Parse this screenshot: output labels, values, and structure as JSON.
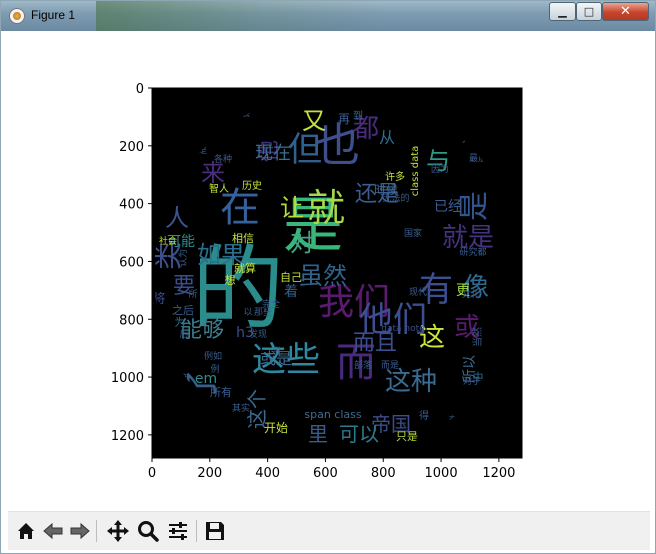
{
  "window": {
    "title": "Figure 1",
    "controls": {
      "minimize": "▁",
      "maximize": "□",
      "close": "✕"
    }
  },
  "plot": {
    "x_ticks": [
      "0",
      "200",
      "400",
      "600",
      "800",
      "1000",
      "1200"
    ],
    "y_ticks": [
      "0",
      "200",
      "400",
      "600",
      "800",
      "1000",
      "1200"
    ],
    "x_tick_values": [
      0,
      200,
      400,
      600,
      800,
      1000,
      1200
    ],
    "y_tick_values": [
      0,
      200,
      400,
      600,
      800,
      1000,
      1200
    ],
    "x_range": [
      0,
      1280
    ],
    "y_range": [
      0,
      1280
    ],
    "image_background": "#000000"
  },
  "wordcloud": {
    "words": [
      {
        "t": "的",
        "color": "#2a8d8c"
      },
      {
        "t": "是",
        "color": "#38b77a"
      },
      {
        "t": "在",
        "color": "#35619c"
      },
      {
        "t": "也",
        "color": "#3e4f8c"
      },
      {
        "t": "但",
        "color": "#32608e"
      },
      {
        "t": "就",
        "color": "#a3d94a"
      },
      {
        "t": "我们",
        "color": "#5a1b6e"
      },
      {
        "t": "而",
        "color": "#4a2a7e"
      },
      {
        "t": "了",
        "color": "#35608c"
      },
      {
        "t": "这些",
        "color": "#2d88a0"
      },
      {
        "t": "他们",
        "color": "#3b4f92"
      },
      {
        "t": "有",
        "color": "#3b4f92"
      },
      {
        "t": "像",
        "color": "#2f6a8f"
      },
      {
        "t": "是",
        "color": "#33558f"
      },
      {
        "t": "就是",
        "color": "#46337f"
      },
      {
        "t": "或",
        "color": "#5a1b6e"
      },
      {
        "t": "这",
        "color": "#cde43a"
      },
      {
        "t": "如果",
        "color": "#2b6e8e"
      },
      {
        "t": "虽然",
        "color": "#30628c"
      },
      {
        "t": "都",
        "color": "#4a2d7d"
      },
      {
        "t": "还是",
        "color": "#3a5d8f"
      },
      {
        "t": "让",
        "color": "#b5df3b"
      },
      {
        "t": "对",
        "color": "#45a285"
      },
      {
        "t": "又",
        "color": "#c4e23a"
      },
      {
        "t": "与",
        "color": "#2c9c88"
      },
      {
        "t": "类",
        "color": "#3e4f8c"
      },
      {
        "t": "人",
        "color": "#3b528b"
      },
      {
        "t": "来",
        "color": "#4a2d7d"
      },
      {
        "t": "他",
        "color": "#442f7a"
      },
      {
        "t": "现在",
        "color": "#3b6e92"
      },
      {
        "t": "从",
        "color": "#2e6f8e"
      },
      {
        "t": "要",
        "color": "#3a4f90"
      },
      {
        "t": "能够",
        "color": "#3b7d8f"
      },
      {
        "t": "这种",
        "color": "#3a6b91"
      },
      {
        "t": "而且",
        "color": "#3a4f90"
      },
      {
        "t": "帝国",
        "color": "#3d4d8a"
      },
      {
        "t": "里",
        "color": "#3a5a8f"
      },
      {
        "t": "可以",
        "color": "#2e7b8c"
      },
      {
        "t": "这个",
        "color": "#3a6b91"
      },
      {
        "t": "可能",
        "color": "#2f8b8c"
      },
      {
        "t": "将",
        "color": "#3a4f90"
      },
      {
        "t": "或是",
        "color": "#3e6b90"
      },
      {
        "t": "更",
        "color": "#a4dd45"
      },
      {
        "t": "着",
        "color": "#35608c"
      },
      {
        "t": "em",
        "color": "#2f8b8c"
      },
      {
        "t": "h3",
        "color": "#3a4f90"
      },
      {
        "t": "所以",
        "color": "#3e6b90"
      },
      {
        "t": "已经",
        "color": "#3a5d8f"
      },
      {
        "t": "只是",
        "color": "#b9de3a"
      },
      {
        "t": "开始",
        "color": "#c7e03a"
      },
      {
        "t": "span class",
        "color": "#3e6b90"
      },
      {
        "t": "data note",
        "color": "#3a4f90"
      },
      {
        "t": "class data",
        "color": "#c4e23a"
      },
      {
        "t": "时候",
        "color": "#3e6b90"
      },
      {
        "t": "自己",
        "color": "#c4e23a"
      },
      {
        "t": "当然",
        "color": "#3a5d8f"
      },
      {
        "t": "再",
        "color": "#3a5d8f"
      },
      {
        "t": "到",
        "color": "#2e6f8e"
      },
      {
        "t": "相信",
        "color": "#c4e23a"
      },
      {
        "t": "就算",
        "color": "#c4e23a"
      },
      {
        "t": "想",
        "color": "#c4e23a"
      },
      {
        "t": "所有",
        "color": "#3a5d8f"
      },
      {
        "t": "为",
        "color": "#2e6f8e"
      },
      {
        "t": "之后",
        "color": "#3a5d8f"
      },
      {
        "t": "例如",
        "color": "#3a5d8f"
      },
      {
        "t": "研究都",
        "color": "#3a5d8f"
      },
      {
        "t": "因为",
        "color": "#3a5d8f"
      },
      {
        "t": "国家",
        "color": "#3a5d8f"
      },
      {
        "t": "无法的",
        "color": "#3a5d8f"
      },
      {
        "t": "许多",
        "color": "#c4e23a"
      },
      {
        "t": "智人",
        "color": "#c4e23a"
      },
      {
        "t": "历史",
        "color": "#c4e23a"
      },
      {
        "t": "各种",
        "color": "#3a5d8f"
      },
      {
        "t": "于是",
        "color": "#3a5d8f"
      },
      {
        "t": "文化",
        "color": "#3a5d8f"
      },
      {
        "t": "现代",
        "color": "#3a5d8f"
      },
      {
        "t": "得",
        "color": "#3a5d8f"
      },
      {
        "t": "会",
        "color": "#3a5d8f"
      },
      {
        "t": "只有",
        "color": "#3a5d8f"
      },
      {
        "t": "最后",
        "color": "#3a5d8f"
      },
      {
        "t": "社会",
        "color": "#c4e23a"
      },
      {
        "t": "那些",
        "color": "#3a5d8f"
      },
      {
        "t": "以",
        "color": "#3a5d8f"
      },
      {
        "t": "发现",
        "color": "#3a5d8f"
      },
      {
        "t": "中",
        "color": "#2e6f8e"
      },
      {
        "t": "后",
        "color": "#3a5d8f"
      },
      {
        "t": "第",
        "color": "#3a5d8f"
      },
      {
        "t": "其实",
        "color": "#3a5d8f"
      },
      {
        "t": "对于",
        "color": "#3a5d8f"
      },
      {
        "t": "而是",
        "color": "#3a5d8f"
      },
      {
        "t": "例",
        "color": "#3a5d8f"
      },
      {
        "t": "所",
        "color": "#3a5d8f"
      },
      {
        "t": "认为",
        "color": "#3a5d8f"
      },
      {
        "t": "完全",
        "color": "#3a5d8f"
      },
      {
        "t": "部落",
        "color": "#3a5d8f"
      },
      {
        "t": "孔",
        "color": "#3a5d8f"
      },
      {
        "t": "大多数",
        "color": "#3a5d8f"
      },
      {
        "t": "农民",
        "color": "#3a5d8f"
      }
    ]
  },
  "toolbar": {
    "buttons": [
      {
        "name": "home-button",
        "icon": "home-icon"
      },
      {
        "name": "back-button",
        "icon": "arrow-left-icon"
      },
      {
        "name": "forward-button",
        "icon": "arrow-right-icon"
      },
      {
        "name": "pan-button",
        "icon": "move-icon"
      },
      {
        "name": "zoom-button",
        "icon": "magnifier-icon"
      },
      {
        "name": "configure-subplots-button",
        "icon": "sliders-icon"
      },
      {
        "name": "save-button",
        "icon": "floppy-disk-icon"
      }
    ]
  }
}
